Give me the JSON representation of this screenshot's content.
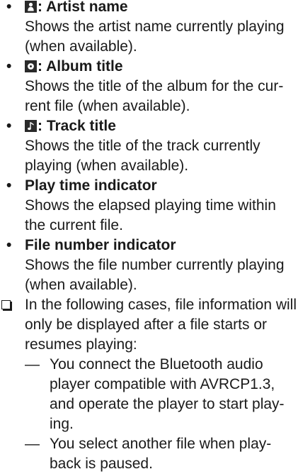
{
  "items": [
    {
      "icon": "artist-icon",
      "title": "Artist name",
      "desc": "Shows the artist name currently playing (when available)."
    },
    {
      "icon": "album-icon",
      "title": "Album title",
      "desc_lines": [
        "Shows the title of the album for the cur-",
        "rent file (when available)."
      ]
    },
    {
      "icon": "note-icon",
      "title": "Track title",
      "desc": "Shows the title of the track currently playing (when available)."
    },
    {
      "title": "Play time indicator",
      "desc": "Shows the elapsed playing time within the current file."
    },
    {
      "title": "File number indicator",
      "desc": "Shows the file number currently playing (when available)."
    }
  ],
  "bullet_char": "•",
  "icon_separator": ":",
  "note": {
    "text": "In the following cases, file information will only be displayed after a file starts or resumes playing:",
    "dash_char": "—",
    "subitems": [
      {
        "lines": [
          "You connect the Bluetooth audio",
          "player compatible with AVRCP1.3,",
          "and operate the player to start play-",
          "ing."
        ]
      },
      {
        "lines": [
          "You select another file when play-",
          "back is paused."
        ]
      }
    ]
  }
}
